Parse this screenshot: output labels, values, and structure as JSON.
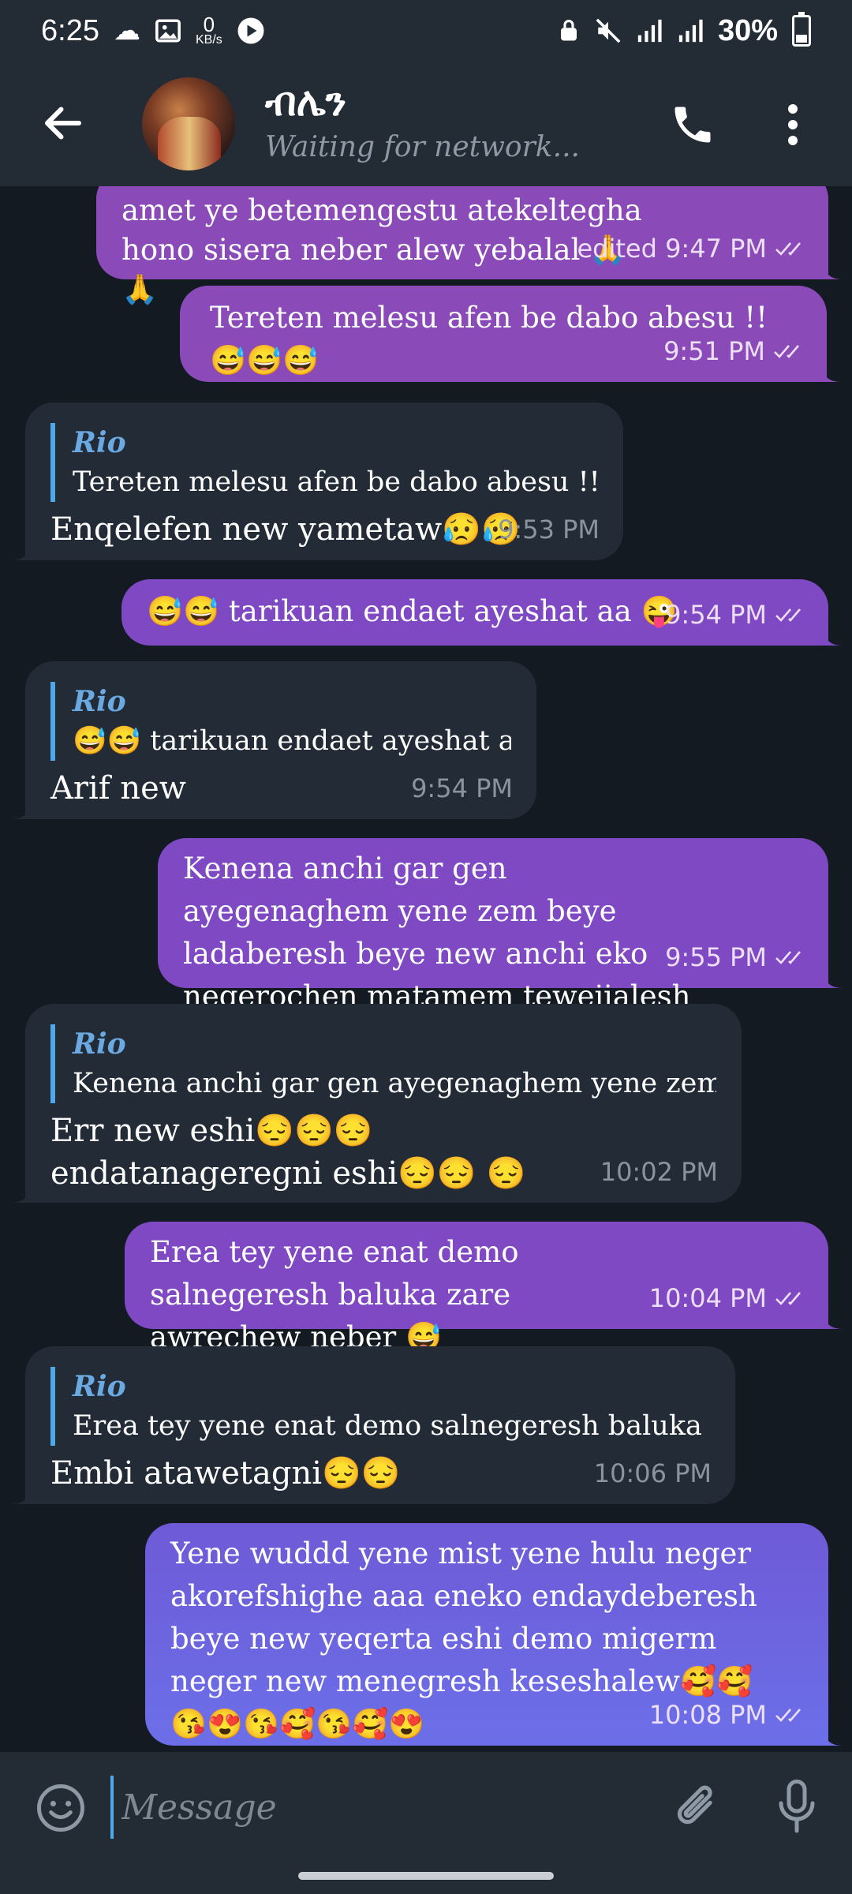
{
  "status_bar": {
    "time": "6:25",
    "net_speed_value": "0",
    "net_speed_unit": "KB/s",
    "battery": "30%",
    "icons": [
      "cloud-icon",
      "gallery-icon",
      "play-icon",
      "lock-icon",
      "mute-icon",
      "signal-icon",
      "signal-icon",
      "battery-icon"
    ]
  },
  "header": {
    "title": "ብሌን",
    "status": "Waiting for network..."
  },
  "messages": [
    {
      "dir": "out",
      "text": "amet ye betemengestu atekeltegha hono sisera neber alew yebalal 🙏🙏",
      "time": "edited 9:47 PM"
    },
    {
      "dir": "out",
      "text": "Tereten melesu afen be dabo abesu !!😅😅😅",
      "time": "9:51 PM"
    },
    {
      "dir": "in",
      "reply_name": "Rio",
      "reply_text": "Tereten melesu afen be dabo abesu !!😅😅😅",
      "text": "Enqelefen new yametaw😥😥",
      "time": "9:53 PM"
    },
    {
      "dir": "out",
      "text": "😅😅 tarikuan endaet ayeshat aa 😜",
      "time": "9:54 PM"
    },
    {
      "dir": "in",
      "reply_name": "Rio",
      "reply_text": "😅😅 tarikuan endaet ayeshat aa 😜",
      "text": "Arif new",
      "time": "9:54 PM"
    },
    {
      "dir": "out",
      "text": "Kenena anchi gar gen ayegenaghem yene zem beye ladaberesh beye new anchi eko negerochen matamem tewejialesh 🙈",
      "time": "9:55 PM"
    },
    {
      "dir": "in",
      "reply_name": "Rio",
      "reply_text": "Kenena anchi gar gen ayegenaghem yene zem beye lad...",
      "text": "Err new eshi😔😔😔endatanageregni eshi😔😔 😔",
      "time": "10:02 PM"
    },
    {
      "dir": "out",
      "text": "Erea tey yene enat demo salnegeresh baluka  zare awrechew neber 😅",
      "time": "10:04 PM"
    },
    {
      "dir": "in",
      "reply_name": "Rio",
      "reply_text": "Erea tey yene enat demo salnegeresh baluka  zare awr...",
      "text": "Embi atawetagni😔😔",
      "time": "10:06 PM"
    },
    {
      "dir": "out",
      "text": "Yene wuddd yene mist yene hulu neger akorefshighe aaa eneko endaydeberesh beye new yeqerta eshi demo migerm neger new menegresh keseshalew🥰🥰😘😍😘🥰😘🥰😍",
      "time": "10:08 PM"
    }
  ],
  "input": {
    "placeholder": "Message"
  },
  "colors": {
    "background": "#131a22",
    "header": "#232b35",
    "outgoing": "#8a4bb8",
    "incoming": "#232c36",
    "reply_accent": "#4fa8e8"
  }
}
